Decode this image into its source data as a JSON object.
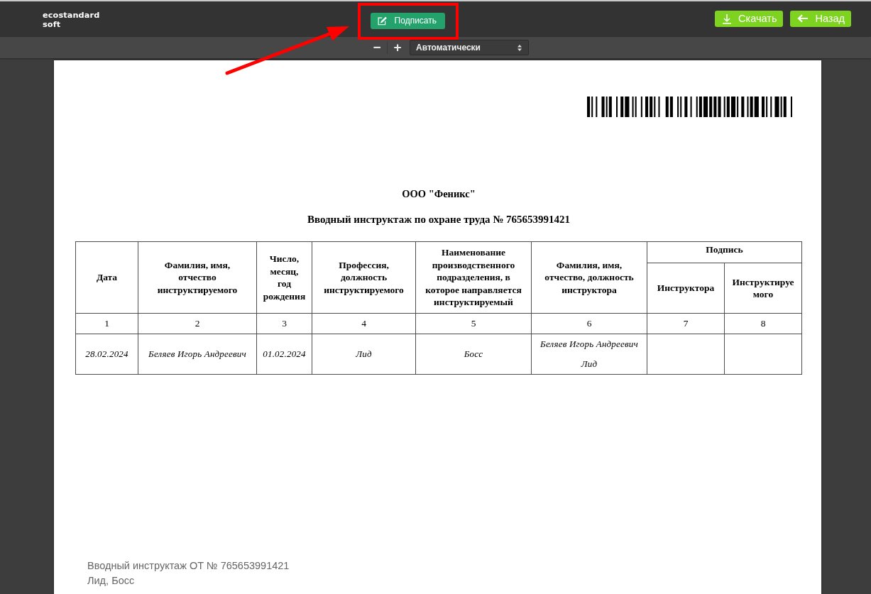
{
  "header": {
    "logo": [
      "ecostandard",
      "soft"
    ],
    "sign_button": {
      "label": "Подписать"
    },
    "buttons": [
      {
        "kind": "download",
        "label": "Скачать"
      },
      {
        "kind": "back",
        "label": "Назад"
      }
    ]
  },
  "toolbar": {
    "zoom_out": "−",
    "zoom_in": "+",
    "scale": "Автоматически"
  },
  "document": {
    "company": "ООО \"Феникс\"",
    "title": "Вводный инструктаж по охране труда № 765653991421",
    "table": {
      "columns": [
        {
          "label": "Дата"
        },
        {
          "label": "Фамилия, имя, отчество инструктируемого"
        },
        {
          "label": "Число, месяц, год рождения"
        },
        {
          "label": "Профессия, должность инструктируемого"
        },
        {
          "label": "Наименование производственного подразделения, в которое направляется инструктируемый"
        },
        {
          "label": "Фамилия, имя, отчество, должность инструктора"
        },
        {
          "label": "Подпись",
          "children": [
            {
              "label": "Инструктора"
            },
            {
              "label": "Инструктируемого"
            }
          ]
        }
      ],
      "numbers": [
        "1",
        "2",
        "3",
        "4",
        "5",
        "6",
        "7",
        "8"
      ],
      "rows": [
        {
          "cells": [
            [
              "28.02.2024"
            ],
            [
              "Беляев Игорь Андреевич"
            ],
            [
              "01.02.2024"
            ],
            [
              "Лид"
            ],
            [
              "Босс"
            ],
            [
              "Беляев Игорь Андреевич",
              "Лид"
            ]
          ]
        }
      ]
    },
    "footer": [
      "Вводный инструктаж ОТ № 765653991421",
      "Лид, Босс"
    ]
  }
}
